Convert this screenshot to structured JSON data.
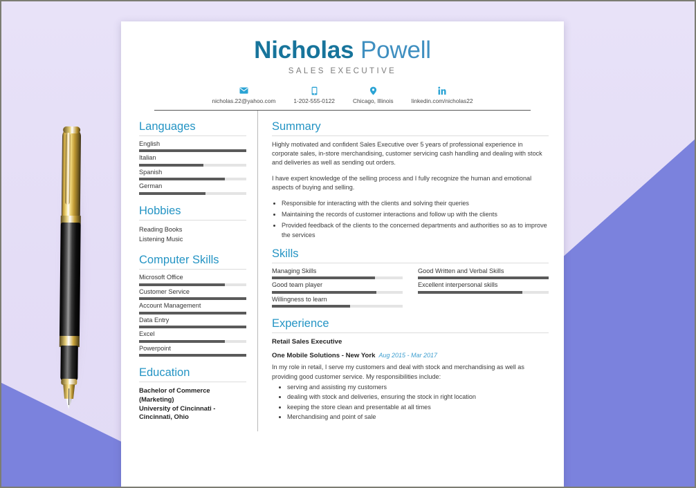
{
  "header": {
    "first_name": "Nicholas",
    "last_name": "Powell",
    "job_title": "SALES EXECUTIVE",
    "contacts": [
      {
        "icon": "envelope-icon",
        "text": "nicholas.22@yahoo.com"
      },
      {
        "icon": "phone-icon",
        "text": "1-202-555-0122"
      },
      {
        "icon": "location-pin-icon",
        "text": "Chicago, Illinois"
      },
      {
        "icon": "linkedin-icon",
        "text": "linkedin.com/nicholas22"
      }
    ]
  },
  "sidebar": {
    "languages": {
      "heading": "Languages",
      "items": [
        {
          "label": "English",
          "level": 100
        },
        {
          "label": "Italian",
          "level": 60
        },
        {
          "label": "Spanish",
          "level": 80
        },
        {
          "label": "German",
          "level": 62
        }
      ]
    },
    "hobbies": {
      "heading": "Hobbies",
      "items": [
        "Reading Books",
        "Listening Music"
      ]
    },
    "computer_skills": {
      "heading": "Computer Skills",
      "items": [
        {
          "label": "Microsoft Office",
          "level": 80
        },
        {
          "label": "Customer Service",
          "level": 100
        },
        {
          "label": "Account Management",
          "level": 100
        },
        {
          "label": "Data Entry",
          "level": 100
        },
        {
          "label": "Excel",
          "level": 80
        },
        {
          "label": "Powerpoint",
          "level": 100
        }
      ]
    },
    "education": {
      "heading": "Education",
      "degree": "Bachelor of Commerce (Marketing)",
      "school": "University of Cincinnati - Cincinnati, Ohio"
    }
  },
  "main": {
    "summary": {
      "heading": "Summary",
      "paragraphs": [
        "Highly motivated and confident Sales Executive over 5 years of professional experience in corporate sales, in-store merchandising, customer servicing cash handling and dealing with stock and deliveries as well as sending out orders.",
        "I have expert knowledge of the selling process and I fully recognize the human and emotional aspects of buying and selling."
      ],
      "bullets": [
        "Responsible for interacting with the clients and solving their queries",
        "Maintaining the records of customer interactions and follow up with the clients",
        "Provided feedback of the clients to the concerned departments and authorities so as to improve the services"
      ]
    },
    "skills": {
      "heading": "Skills",
      "left_column": [
        {
          "label": "Managing Skills",
          "level": 79
        },
        {
          "label": "Good team player",
          "level": 80
        },
        {
          "label": "Willingness to learn",
          "level": 60
        }
      ],
      "right_column": [
        {
          "label": "Good Written and Verbal Skills",
          "level": 100
        },
        {
          "label": "Excellent interpersonal skills",
          "level": 80
        }
      ]
    },
    "experience": {
      "heading": "Experience",
      "role": "Retail Sales Executive",
      "company": "One Mobile Solutions - New York",
      "dates": "Aug 2015 - Mar 2017",
      "description": "In my role in retail, I serve my customers and deal with stock and merchandising as well as providing good customer service. My responsibilities include:",
      "bullets": [
        "serving and assisting my customers",
        "dealing with stock and deliveries, ensuring the stock in right location",
        "keeping the store clean and presentable at all times",
        "Merchandising and point of sale"
      ]
    }
  },
  "colors": {
    "heading_teal": "#2494c4",
    "name_first": "#17749b",
    "name_last": "#3f8fc0",
    "icon_blue": "#2aa3d4",
    "bar_fill": "#5a5a5a",
    "bar_track": "#e4e4e4",
    "background_lavender": "#e6e0f7",
    "background_purple": "#7b82dd"
  }
}
